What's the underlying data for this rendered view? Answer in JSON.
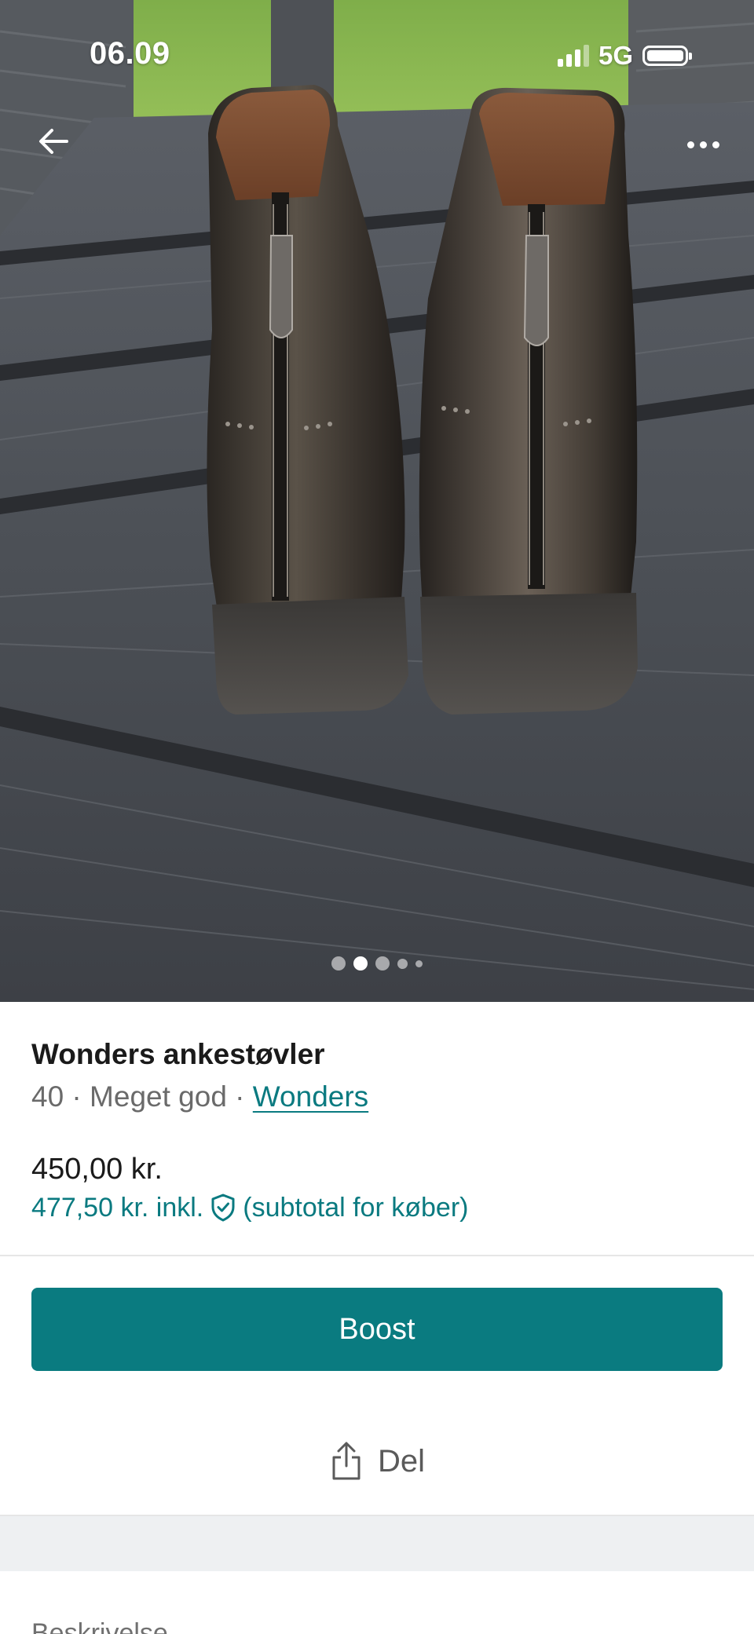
{
  "status_bar": {
    "time": "06.09",
    "network": "5G",
    "icons": [
      "signal-bars-icon",
      "battery-icon"
    ]
  },
  "top_nav": {
    "back_icon": "arrow-left-icon",
    "more_icon": "more-horizontal-icon"
  },
  "gallery": {
    "image_count": 5,
    "current_index": 2
  },
  "listing": {
    "title": "Wonders ankestøvler",
    "size": "40",
    "separator": " · ",
    "condition": "Meget god",
    "brand": "Wonders",
    "price": "450,00 kr.",
    "price_incl": "477,50 kr. inkl.",
    "protection_icon": "shield-check-icon",
    "price_incl_note": "(subtotal for køber)"
  },
  "actions": {
    "boost_label": "Boost",
    "share_label": "Del",
    "share_icon": "share-icon"
  },
  "sections": {
    "description_label": "Beskrivelse"
  },
  "colors": {
    "accent": "#0a7b80",
    "link": "#0a7a80",
    "text_primary": "#1a1a1a",
    "text_secondary": "#6a6a6a",
    "band": "#eef0f2"
  }
}
